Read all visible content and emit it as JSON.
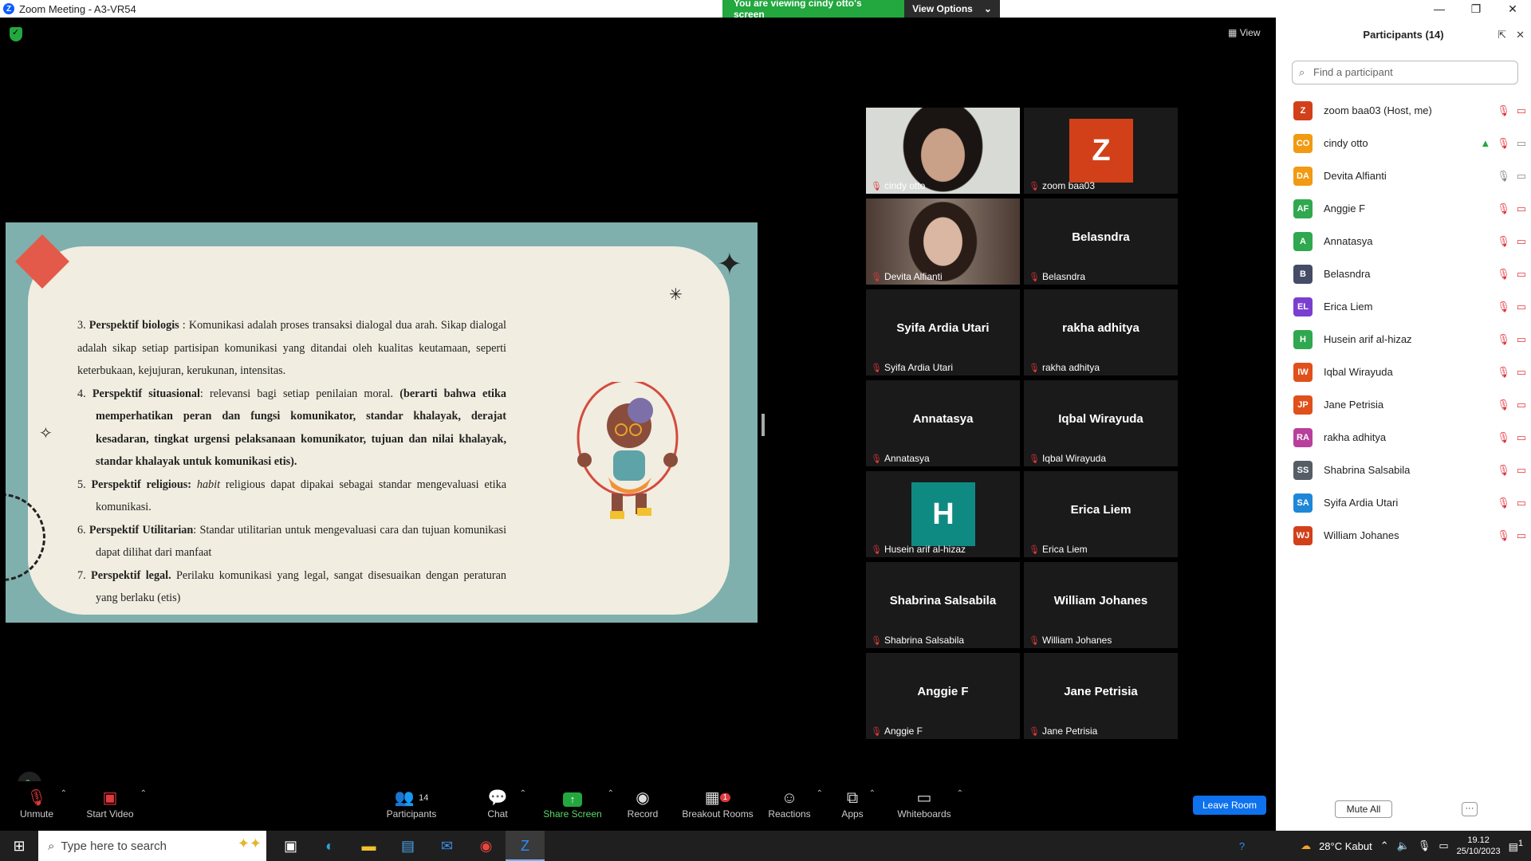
{
  "window": {
    "title": "Zoom Meeting - A3-VR54",
    "banner": "You are viewing cindy otto's screen",
    "view_options": "View Options",
    "view_label": "View"
  },
  "slide": {
    "p3_num": "3.",
    "p3_bold": "Perspektif biologis",
    "p3_text": " : Komunikasi adalah proses transaksi dialogal dua arah. Sikap dialogal adalah sikap setiap partisipan komunikasi yang ditandai oleh kualitas keutamaan, seperti keterbukaan, kejujuran, kerukunan, intensitas.",
    "p4_num": "4.",
    "p4_bold": "Perspektif situasional",
    "p4_text": ": relevansi bagi setiap penilaian moral. ",
    "p4_bold2": "(berarti bahwa etika memperhatikan peran dan fungsi komunikator, standar khalayak, derajat kesadaran, tingkat urgensi pelaksanaan komunikator, tujuan dan nilai khalayak, standar khalayak untuk komunikasi etis).",
    "p5_num": "5.",
    "p5_bold": "Perspektif religious:",
    "p5_italic": " habit",
    "p5_text": " religious dapat dipakai sebagai standar mengevaluasi etika komunikasi.",
    "p6_num": "6.",
    "p6_bold": "Perspektif Utilitarian",
    "p6_text": ": Standar utilitarian untuk mengevaluasi cara dan tujuan komunikasi dapat dilihat dari manfaat",
    "p7_num": "7.",
    "p7_bold": "Perspektif legal.",
    "p7_text": " Perilaku komunikasi yang legal, sangat disesuaikan dengan peraturan yang berlaku (etis)"
  },
  "tiles": [
    {
      "big": "",
      "label": "cindy otto",
      "kind": "video"
    },
    {
      "big": "Z",
      "label": "zoom baa03",
      "kind": "avatar",
      "color": "#d2401a"
    },
    {
      "big": "",
      "label": "Devita Alfianti",
      "kind": "video2"
    },
    {
      "big": "Belasndra",
      "label": "Belasndra",
      "kind": "name"
    },
    {
      "big": "Syifa Ardia Utari",
      "label": "Syifa Ardia Utari",
      "kind": "name"
    },
    {
      "big": "rakha adhitya",
      "label": "rakha adhitya",
      "kind": "name"
    },
    {
      "big": "Annatasya",
      "label": "Annatasya",
      "kind": "name"
    },
    {
      "big": "Iqbal Wirayuda",
      "label": "Iqbal Wirayuda",
      "kind": "name"
    },
    {
      "big": "H",
      "label": "Husein arif al-hizaz",
      "kind": "avatar",
      "color": "#0f8a83"
    },
    {
      "big": "Erica Liem",
      "label": "Erica Liem",
      "kind": "name"
    },
    {
      "big": "Shabrina Salsabila",
      "label": "Shabrina Salsabila",
      "kind": "name"
    },
    {
      "big": "William Johanes",
      "label": "William Johanes",
      "kind": "name"
    },
    {
      "big": "Anggie F",
      "label": "Anggie F",
      "kind": "name"
    },
    {
      "big": "Jane Petrisia",
      "label": "Jane Petrisia",
      "kind": "name"
    }
  ],
  "toolbar": {
    "unmute": "Unmute",
    "start_video": "Start Video",
    "participants": "Participants",
    "participants_count": "14",
    "chat": "Chat",
    "share_screen": "Share Screen",
    "record": "Record",
    "breakout_rooms": "Breakout Rooms",
    "breakout_badge": "1",
    "reactions": "Reactions",
    "apps": "Apps",
    "whiteboards": "Whiteboards",
    "leave_room": "Leave Room"
  },
  "panel": {
    "title": "Participants (14)",
    "search_placeholder": "Find a participant",
    "mute_all": "Mute All",
    "more": "···",
    "participants": [
      {
        "initials": "Z",
        "name": "zoom baa03 (Host, me)",
        "color": "#d2401a"
      },
      {
        "initials": "CO",
        "name": "cindy otto",
        "color": "#f19a12"
      },
      {
        "initials": "DA",
        "name": "Devita Alfianti",
        "color": "#f19a12"
      },
      {
        "initials": "AF",
        "name": "Anggie F",
        "color": "#2fa84f"
      },
      {
        "initials": "A",
        "name": "Annatasya",
        "color": "#2fa84f"
      },
      {
        "initials": "B",
        "name": "Belasndra",
        "color": "#444c66"
      },
      {
        "initials": "EL",
        "name": "Erica Liem",
        "color": "#7a3fcf"
      },
      {
        "initials": "H",
        "name": "Husein arif al-hizaz",
        "color": "#2fa84f"
      },
      {
        "initials": "IW",
        "name": "Iqbal Wirayuda",
        "color": "#e0501a"
      },
      {
        "initials": "JP",
        "name": "Jane Petrisia",
        "color": "#e0501a"
      },
      {
        "initials": "RA",
        "name": "rakha adhitya",
        "color": "#b8409c"
      },
      {
        "initials": "SS",
        "name": "Shabrina Salsabila",
        "color": "#555d66"
      },
      {
        "initials": "SA",
        "name": "Syifa Ardia Utari",
        "color": "#1e87d8"
      },
      {
        "initials": "WJ",
        "name": "William Johanes",
        "color": "#d2401a"
      }
    ]
  },
  "taskbar": {
    "search_placeholder": "Type here to search",
    "weather": "28°C  Kabut",
    "time": "19.12",
    "date": "25/10/2023",
    "notif_count": "1"
  }
}
